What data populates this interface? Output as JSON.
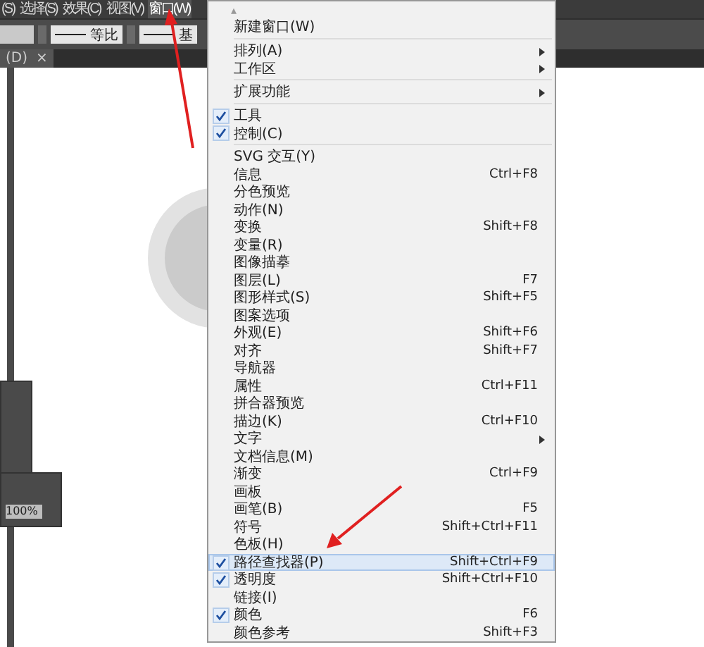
{
  "menubar": {
    "items": [
      {
        "label": "(S)",
        "selected": false
      },
      {
        "label": "选择(S)",
        "selected": false
      },
      {
        "label": "效果(C)",
        "selected": false
      },
      {
        "label": "视图(V)",
        "selected": false
      },
      {
        "label": "窗口(W)",
        "selected": true
      }
    ]
  },
  "toolbar": {
    "stroke_profile": "等比",
    "brush": "基"
  },
  "document_tab": {
    "label": "(D)",
    "close": "×"
  },
  "zoom_field": {
    "value": "100%"
  },
  "menu": {
    "scroll_up": "▴",
    "groups": [
      [
        {
          "label": "新建窗口(W)",
          "submenu": false,
          "checked": false,
          "selected": false
        }
      ],
      [
        {
          "label": "排列(A)",
          "submenu": true,
          "checked": false,
          "selected": false
        },
        {
          "label": "工作区",
          "submenu": true,
          "checked": false,
          "selected": false
        }
      ],
      [
        {
          "label": "扩展功能",
          "submenu": true,
          "checked": false,
          "selected": false
        }
      ],
      [
        {
          "label": "工具",
          "submenu": false,
          "checked": true,
          "selected": false
        },
        {
          "label": "控制(C)",
          "submenu": false,
          "checked": true,
          "selected": false
        }
      ],
      [
        {
          "label": "SVG 交互(Y)",
          "submenu": false,
          "checked": false,
          "selected": false
        },
        {
          "label": "信息",
          "shortcut": "Ctrl+F8",
          "submenu": false,
          "checked": false,
          "selected": false
        },
        {
          "label": "分色预览",
          "submenu": false,
          "checked": false,
          "selected": false
        },
        {
          "label": "动作(N)",
          "submenu": false,
          "checked": false,
          "selected": false
        },
        {
          "label": "变换",
          "shortcut": "Shift+F8",
          "submenu": false,
          "checked": false,
          "selected": false
        },
        {
          "label": "变量(R)",
          "submenu": false,
          "checked": false,
          "selected": false
        },
        {
          "label": "图像描摹",
          "submenu": false,
          "checked": false,
          "selected": false
        },
        {
          "label": "图层(L)",
          "shortcut": "F7",
          "submenu": false,
          "checked": false,
          "selected": false
        },
        {
          "label": "图形样式(S)",
          "shortcut": "Shift+F5",
          "submenu": false,
          "checked": false,
          "selected": false
        },
        {
          "label": "图案选项",
          "submenu": false,
          "checked": false,
          "selected": false
        },
        {
          "label": "外观(E)",
          "shortcut": "Shift+F6",
          "submenu": false,
          "checked": false,
          "selected": false
        },
        {
          "label": "对齐",
          "shortcut": "Shift+F7",
          "submenu": false,
          "checked": false,
          "selected": false
        },
        {
          "label": "导航器",
          "submenu": false,
          "checked": false,
          "selected": false
        },
        {
          "label": "属性",
          "shortcut": "Ctrl+F11",
          "submenu": false,
          "checked": false,
          "selected": false
        },
        {
          "label": "拼合器预览",
          "submenu": false,
          "checked": false,
          "selected": false
        },
        {
          "label": "描边(K)",
          "shortcut": "Ctrl+F10",
          "submenu": false,
          "checked": false,
          "selected": false
        },
        {
          "label": "文字",
          "submenu": true,
          "checked": false,
          "selected": false
        },
        {
          "label": "文档信息(M)",
          "submenu": false,
          "checked": false,
          "selected": false
        },
        {
          "label": "渐变",
          "shortcut": "Ctrl+F9",
          "submenu": false,
          "checked": false,
          "selected": false
        },
        {
          "label": "画板",
          "submenu": false,
          "checked": false,
          "selected": false
        },
        {
          "label": "画笔(B)",
          "shortcut": "F5",
          "submenu": false,
          "checked": false,
          "selected": false
        },
        {
          "label": "符号",
          "shortcut": "Shift+Ctrl+F11",
          "submenu": false,
          "checked": false,
          "selected": false
        },
        {
          "label": "色板(H)",
          "submenu": false,
          "checked": false,
          "selected": false
        },
        {
          "label": "路径查找器(P)",
          "shortcut": "Shift+Ctrl+F9",
          "submenu": false,
          "checked": true,
          "selected": true
        },
        {
          "label": "透明度",
          "shortcut": "Shift+Ctrl+F10",
          "submenu": false,
          "checked": true,
          "selected": false
        },
        {
          "label": "链接(I)",
          "submenu": false,
          "checked": false,
          "selected": false
        },
        {
          "label": "颜色",
          "shortcut": "F6",
          "submenu": false,
          "checked": true,
          "selected": false
        },
        {
          "label": "颜色参考",
          "shortcut": "Shift+F3",
          "submenu": false,
          "checked": false,
          "selected": false
        }
      ]
    ]
  }
}
